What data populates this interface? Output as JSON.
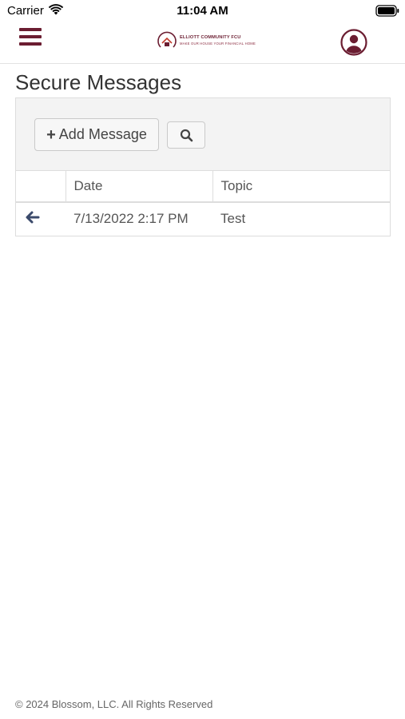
{
  "status_bar": {
    "carrier": "Carrier",
    "time": "11:04 AM"
  },
  "header": {
    "brand_name": "ELLIOTT COMMUNITY FCU",
    "brand_tagline": "MAKE OUR HOUSE YOUR FINANCIAL HOME",
    "menu_icon": "hamburger-menu-icon",
    "profile_icon": "user-circle-icon"
  },
  "page": {
    "title": "Secure Messages"
  },
  "toolbar": {
    "add_label": "Add Message",
    "search_icon": "search-icon"
  },
  "table": {
    "columns": [
      "",
      "Date",
      "Topic"
    ],
    "rows": [
      {
        "icon": "back-arrow-icon",
        "date": "7/13/2022 2:17 PM",
        "topic": "Test"
      }
    ]
  },
  "footer": {
    "text": "© 2024 Blossom, LLC. All Rights Reserved"
  },
  "colors": {
    "brand": "#6b1d31",
    "accent_icon": "#3b4a6b"
  }
}
